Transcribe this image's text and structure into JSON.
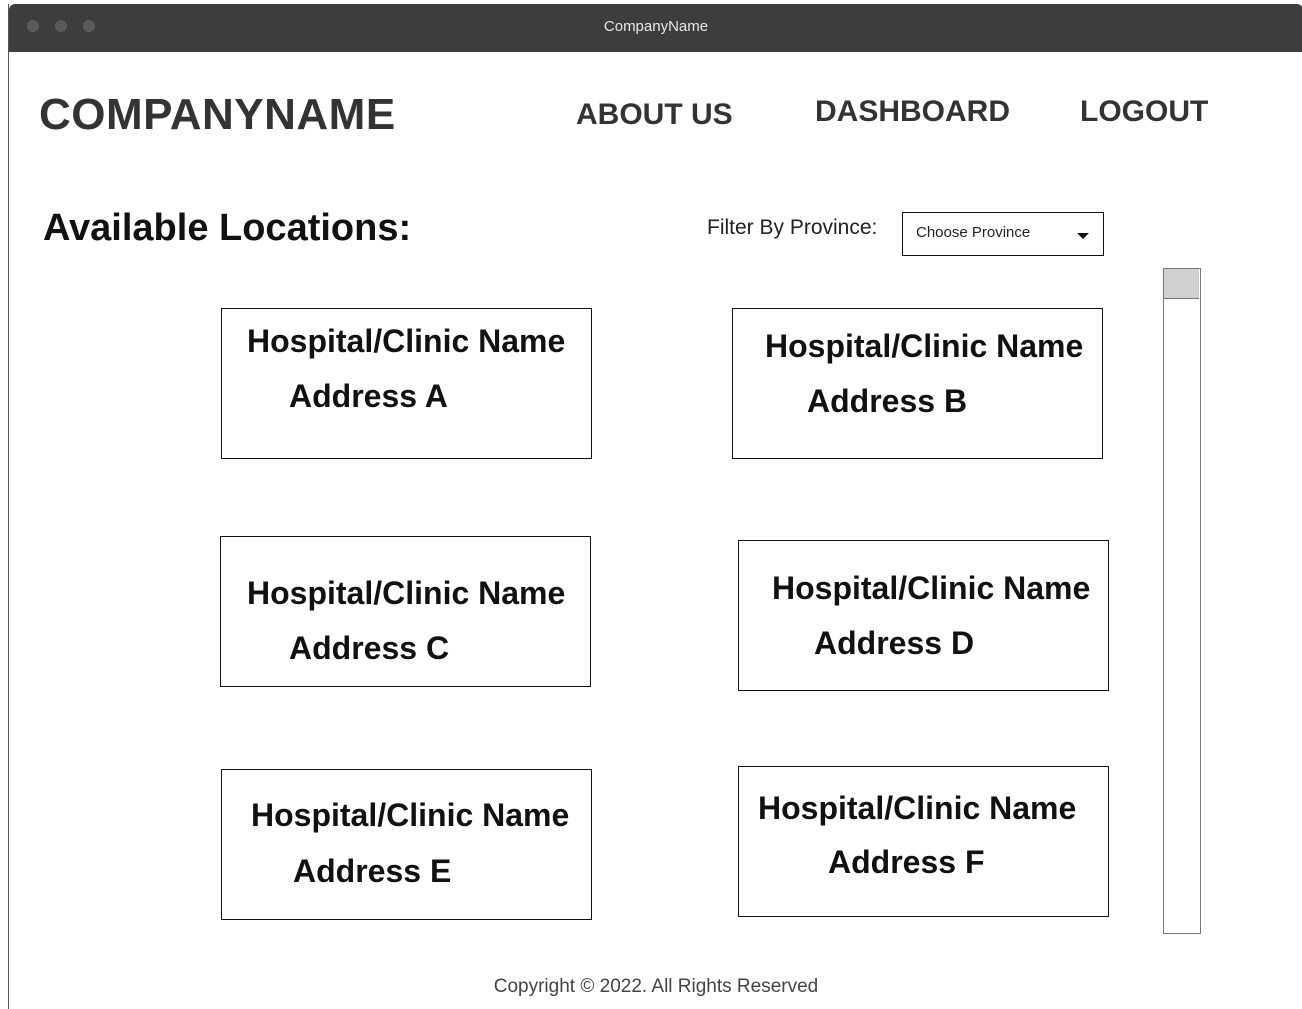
{
  "window": {
    "title": "CompanyName"
  },
  "header": {
    "brand": "COMPANYNAME",
    "nav": {
      "about": "ABOUT US",
      "dashboard": "DASHBOARD",
      "logout": "LOGOUT"
    }
  },
  "main": {
    "title": "Available Locations:",
    "filter": {
      "label": "Filter By Province:",
      "value": "Choose Province"
    },
    "locations": [
      {
        "name": "Hospital/Clinic Name",
        "address": "Address A"
      },
      {
        "name": "Hospital/Clinic Name",
        "address": "Address B"
      },
      {
        "name": "Hospital/Clinic Name",
        "address": "Address C"
      },
      {
        "name": "Hospital/Clinic Name",
        "address": "Address D"
      },
      {
        "name": "Hospital/Clinic Name",
        "address": "Address E"
      },
      {
        "name": "Hospital/Clinic Name",
        "address": "Address F"
      }
    ]
  },
  "footer": {
    "text": "Copyright  © 2022. All Rights Reserved"
  }
}
